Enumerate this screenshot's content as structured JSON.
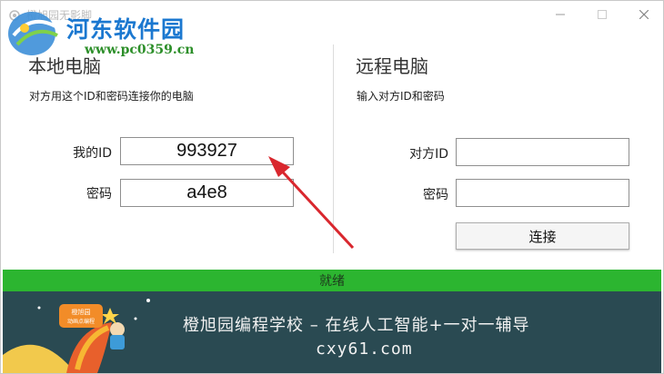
{
  "window": {
    "title": "橙旭园无影脚"
  },
  "watermark": {
    "name": "河东软件园",
    "url": "www.pc0359.cn"
  },
  "local": {
    "title": "本地电脑",
    "description": "对方用这个ID和密码连接你的电脑",
    "id_label": "我的ID",
    "id_value": "993927",
    "password_label": "密码",
    "password_value": "a4e8"
  },
  "remote": {
    "title": "远程电脑",
    "description": "输入对方ID和密码",
    "id_label": "对方ID",
    "id_value": "",
    "password_label": "密码",
    "password_value": "",
    "connect_label": "连接"
  },
  "status": {
    "text": "就绪",
    "color": "#2cb530"
  },
  "banner": {
    "line1": "橙旭园编程学校 – 在线人工智能+一对一辅导",
    "line2": "cxy61.com",
    "badge_line1": "橙旭园",
    "badge_line2": "动画点编程",
    "background": "#2a4a52"
  },
  "annotation": {
    "arrow_color": "#d9272e"
  }
}
